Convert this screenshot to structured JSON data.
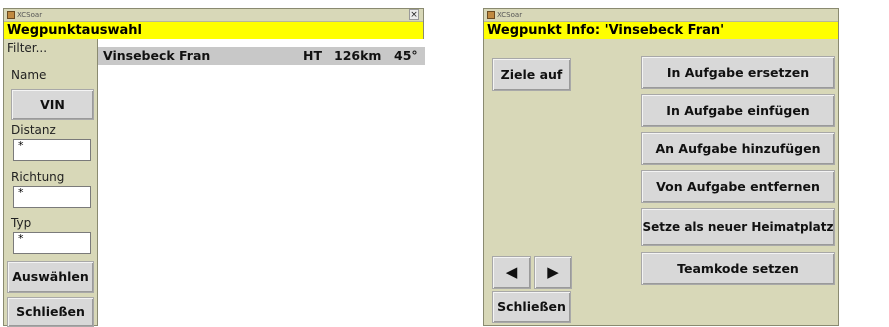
{
  "left_window": {
    "app_title": "XCSoar",
    "close": "×",
    "caption": "Wegpunktauswahl",
    "filter_label": "Filter...",
    "name_label": "Name",
    "name_button": "VIN",
    "distance_label": "Distanz",
    "distance_value": "*",
    "direction_label": "Richtung",
    "direction_value": "*",
    "type_label": "Typ",
    "type_value": "*",
    "select_button": "Auswählen",
    "close_button": "Schließen",
    "list": [
      {
        "name": "Vinsebeck Fran",
        "type": "HT",
        "distance": "126km",
        "bearing": "45°"
      }
    ]
  },
  "right_window": {
    "app_title": "XCSoar",
    "caption": "Wegpunkt Info: 'Vinsebeck Fran'",
    "goto_button": "Ziele auf",
    "replace_button": "In Aufgabe ersetzen",
    "insert_button": "In Aufgabe einfügen",
    "append_button": "An Aufgabe hinzufügen",
    "remove_button": "Von Aufgabe entfernen",
    "home_button": "Setze als neuer Heimatplatz",
    "teamcode_button": "Teamkode setzen",
    "prev_glyph": "◀",
    "next_glyph": "▶",
    "close_button": "Schließen"
  }
}
